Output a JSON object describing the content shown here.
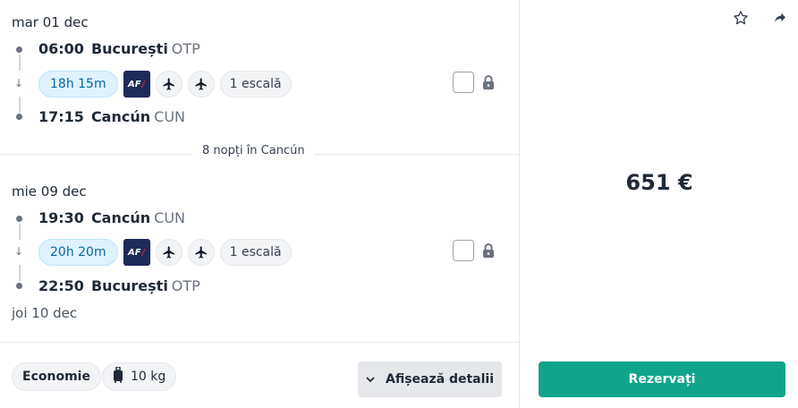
{
  "outbound": {
    "date": "mar 01 dec",
    "departure": {
      "time": "06:00",
      "city": "București",
      "code": "OTP"
    },
    "duration": "18h 15m",
    "airline_logo": "AF",
    "stops": "1 escală",
    "arrival": {
      "time": "17:15",
      "city": "Cancún",
      "code": "CUN"
    }
  },
  "nights_label": "8 nopți în Cancún",
  "inbound": {
    "date": "mie 09 dec",
    "departure": {
      "time": "19:30",
      "city": "Cancún",
      "code": "CUN"
    },
    "duration": "20h 20m",
    "airline_logo": "AF",
    "stops": "1 escală",
    "arrival": {
      "time": "22:50",
      "city": "București",
      "code": "OTP"
    },
    "arrival_date": "joi 10 dec"
  },
  "footer": {
    "cabin_class": "Economie",
    "baggage": "10 kg",
    "details_label": "Afișează detalii"
  },
  "price": "651 €",
  "book_label": "Rezervați",
  "icons": {
    "favorite": "star-icon",
    "share": "share-icon",
    "lock": "lock-icon",
    "plane": "plane-icon",
    "baggage": "cabin-bag-icon",
    "chevron": "chevron-down-icon"
  },
  "colors": {
    "accent": "#10a58a",
    "duration_bg": "#e0f2fe",
    "duration_text": "#0369a1"
  }
}
